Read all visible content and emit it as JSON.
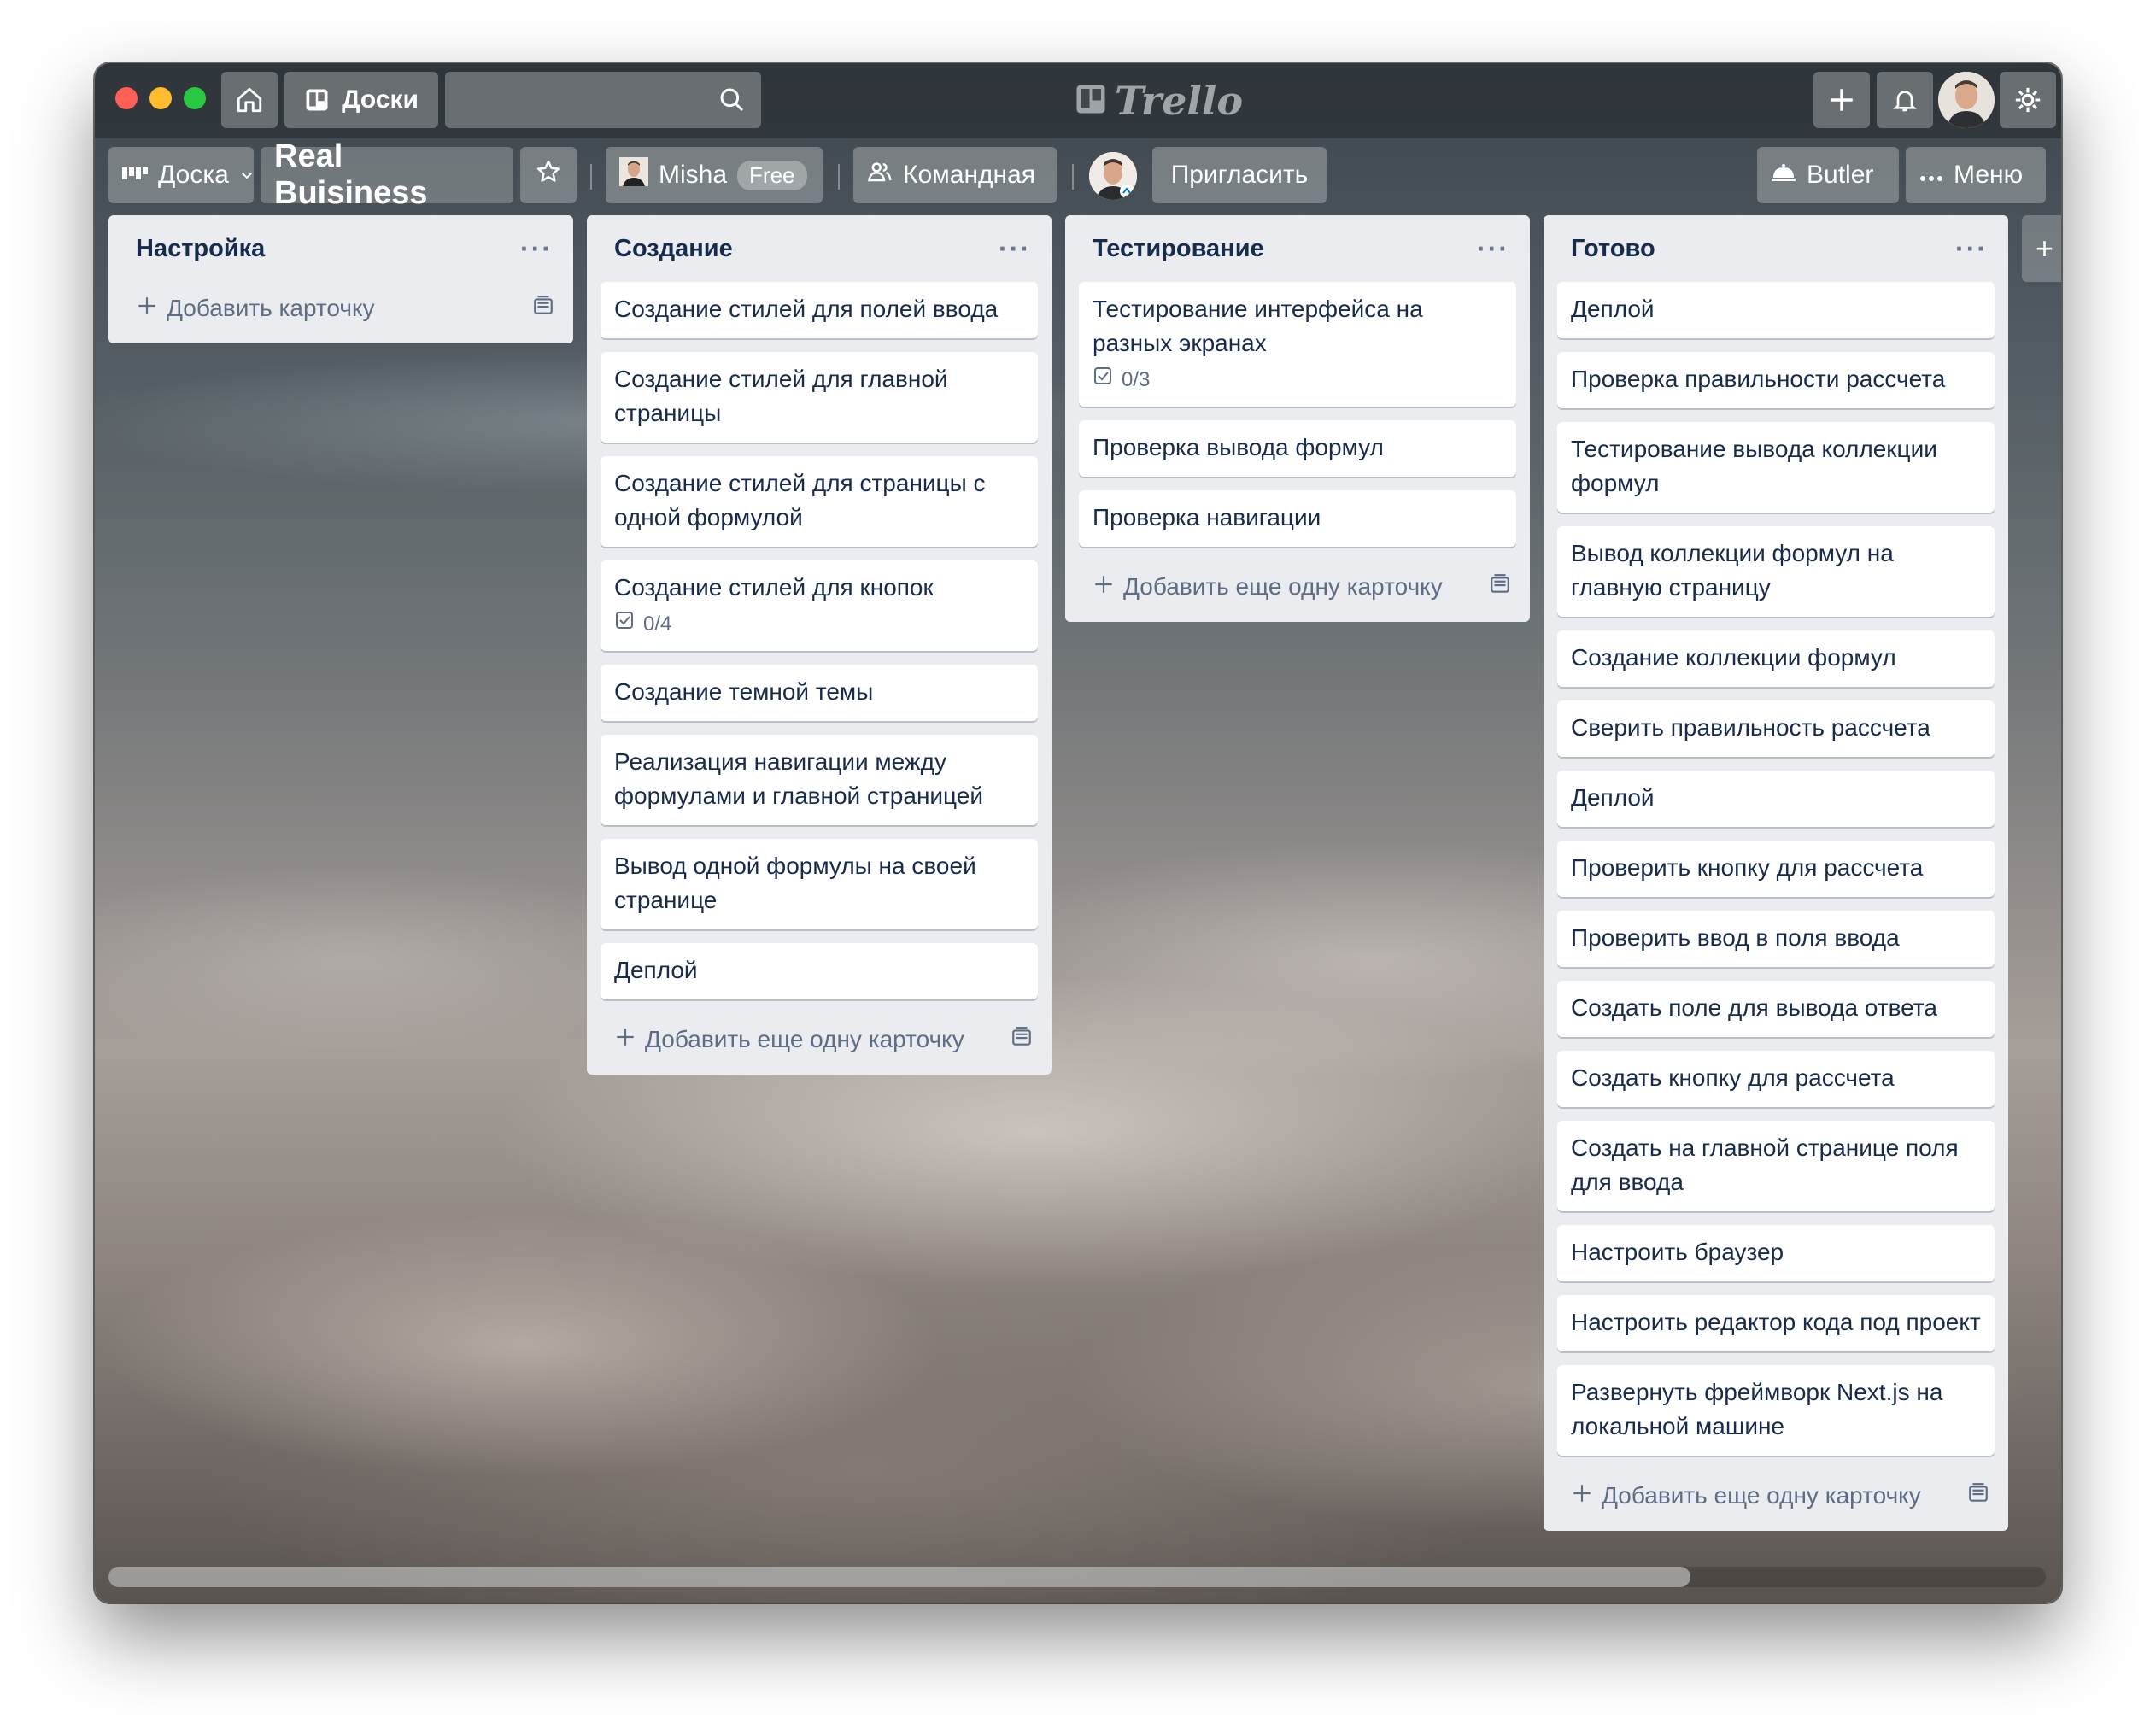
{
  "header": {
    "boards_label": "Доски",
    "search_value": "",
    "logo_text": "Trello"
  },
  "board": {
    "view_label": "Доска",
    "title": "Real Buisiness",
    "member_name": "Misha",
    "plan_badge": "Free",
    "visibility_label": "Командная",
    "invite_label": "Пригласить",
    "butler_label": "Butler",
    "menu_label": "Меню"
  },
  "lists": [
    {
      "title": "Настройка",
      "cards": [],
      "add_label": "Добавить карточку"
    },
    {
      "title": "Создание",
      "cards": [
        {
          "text": "Создание стилей для полей ввода"
        },
        {
          "text": "Создание стилей для главной страницы"
        },
        {
          "text": "Создание стилей для страницы с одной формулой"
        },
        {
          "text": "Создание стилей для кнопок",
          "checklist": "0/4"
        },
        {
          "text": "Создание темной темы"
        },
        {
          "text": "Реализация навигации между формулами и главной страницей"
        },
        {
          "text": "Вывод одной формулы на своей странице"
        },
        {
          "text": "Деплой"
        }
      ],
      "add_label": "Добавить еще одну карточку"
    },
    {
      "title": "Тестирование",
      "cards": [
        {
          "text": "Тестирование интерфейса на разных экранах",
          "checklist": "0/3"
        },
        {
          "text": "Проверка вывода формул"
        },
        {
          "text": "Проверка навигации"
        }
      ],
      "add_label": "Добавить еще одну карточку"
    },
    {
      "title": "Готово",
      "cards": [
        {
          "text": "Деплой"
        },
        {
          "text": "Проверка правильности рассчета"
        },
        {
          "text": "Тестирование вывода коллекции формул"
        },
        {
          "text": "Вывод коллекции формул на главную страницу"
        },
        {
          "text": "Создание коллекции формул"
        },
        {
          "text": "Сверить правильность рассчета"
        },
        {
          "text": "Деплой"
        },
        {
          "text": "Проверить кнопку для рассчета"
        },
        {
          "text": "Проверить ввод в поля ввода"
        },
        {
          "text": "Создать поле для вывода ответа"
        },
        {
          "text": "Создать кнопку для рассчета"
        },
        {
          "text": "Создать на главной странице поля для ввода"
        },
        {
          "text": "Настроить браузер"
        },
        {
          "text": "Настроить редактор кода под проект"
        },
        {
          "text": "Развернуть фреймворк Next.js на локальной машине"
        }
      ],
      "add_label": "Добавить еще одну карточку"
    }
  ],
  "add_list_glyph": "+",
  "colors": {
    "list_bg": "#ebecf0",
    "card_bg": "#ffffff",
    "text": "#172b4d",
    "muted": "#5e6c84"
  }
}
